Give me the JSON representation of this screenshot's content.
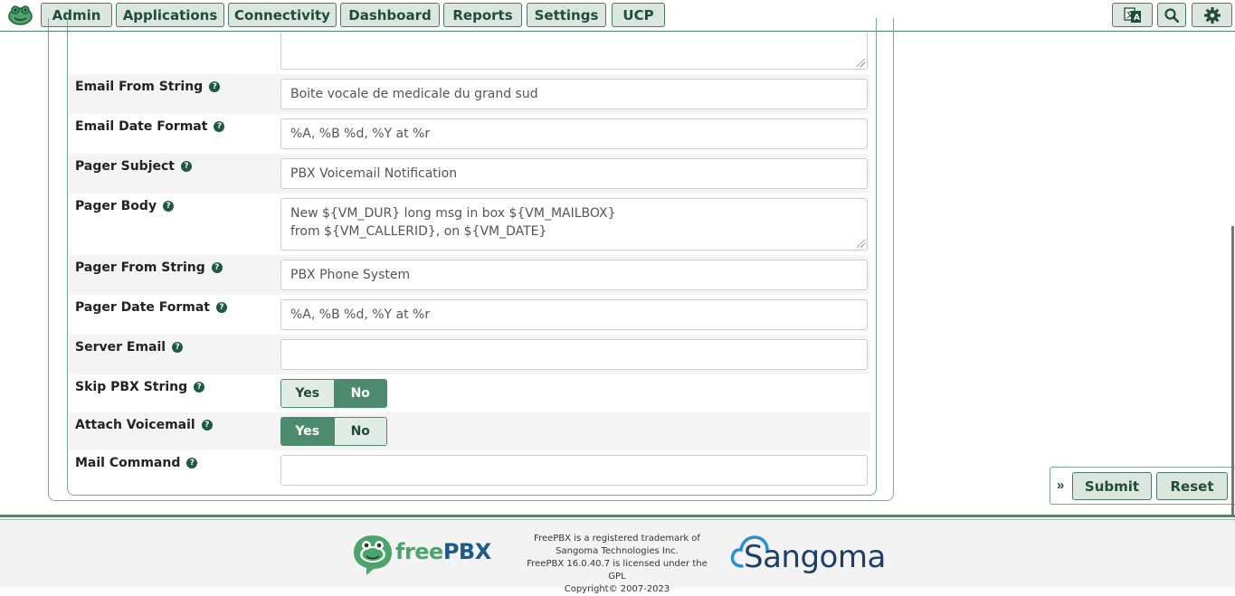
{
  "nav": {
    "items": [
      "Admin",
      "Applications",
      "Connectivity",
      "Dashboard",
      "Reports",
      "Settings",
      "UCP"
    ],
    "icons": [
      "language-icon",
      "search-icon",
      "gear-icon"
    ]
  },
  "form": {
    "email_from_string": {
      "label": "Email From String",
      "value": "Boite vocale de medicale du grand sud"
    },
    "email_date_format": {
      "label": "Email Date Format",
      "value": "%A, %B %d, %Y at %r"
    },
    "pager_subject": {
      "label": "Pager Subject",
      "value": "PBX Voicemail Notification"
    },
    "pager_body": {
      "label": "Pager Body",
      "line1": "New ${VM_DUR} long msg in box ${VM_MAILBOX}",
      "line2": "from ${VM_CALLERID}, on ${VM_DATE}"
    },
    "pager_from_string": {
      "label": "Pager From String",
      "value": "PBX Phone System"
    },
    "pager_date_format": {
      "label": "Pager Date Format",
      "value": "%A, %B %d, %Y at %r"
    },
    "server_email": {
      "label": "Server Email",
      "value": ""
    },
    "skip_pbx_string": {
      "label": "Skip PBX String",
      "yes": "Yes",
      "no": "No",
      "selected": "No"
    },
    "attach_voicemail": {
      "label": "Attach Voicemail",
      "yes": "Yes",
      "no": "No",
      "selected": "Yes"
    },
    "mail_command": {
      "label": "Mail Command",
      "value": ""
    }
  },
  "actions": {
    "chevron": "»",
    "submit": "Submit",
    "reset": "Reset"
  },
  "footer": {
    "freepbx_free": "free",
    "freepbx_pbx": "PBX",
    "legal_1": "FreePBX is a registered trademark of",
    "legal_2": "Sangoma Technologies Inc.",
    "legal_3": "FreePBX 16.0.40.7 is licensed under the",
    "legal_4": "GPL",
    "legal_5": "Copyright© 2007-2023",
    "sangoma": "Sangoma"
  },
  "colors": {
    "brand_green": "#4d8b6e",
    "button_bg": "#dbe6df",
    "text_dark_green": "#1f4d39"
  }
}
